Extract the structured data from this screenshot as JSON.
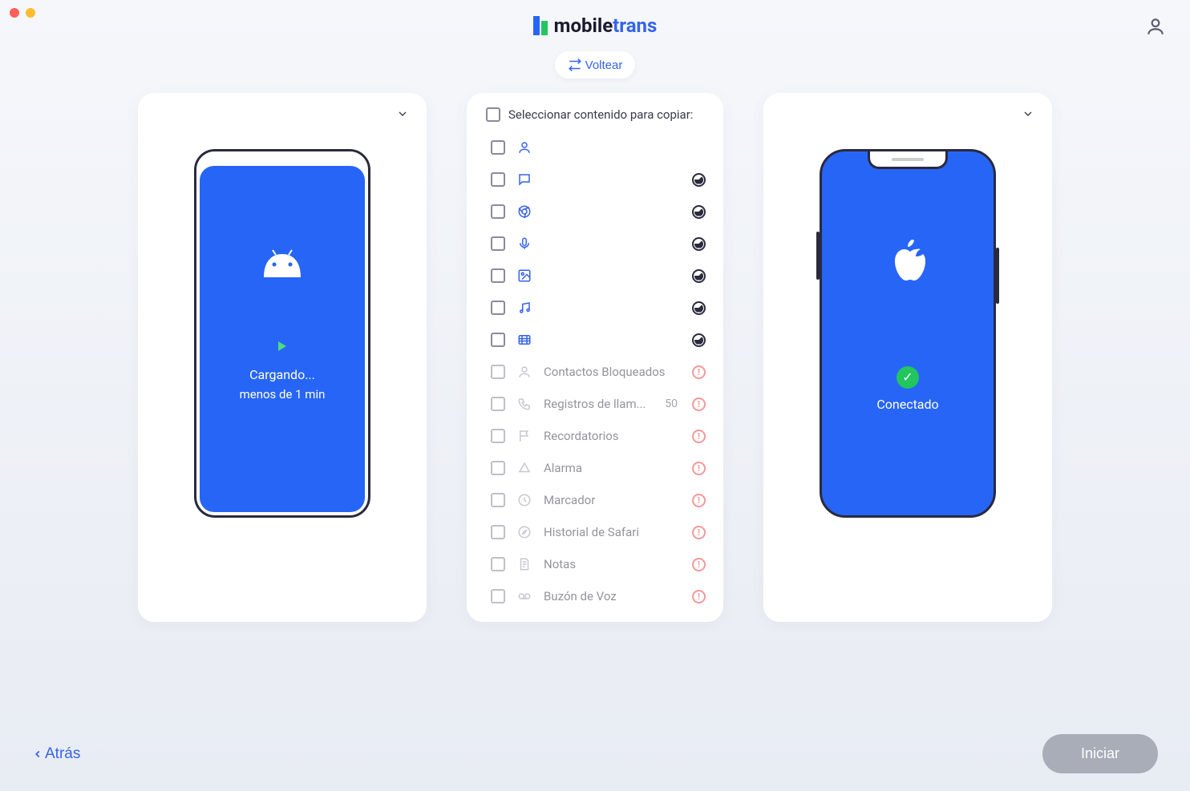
{
  "app": {
    "name_part1": "mobile",
    "name_part2": "trans"
  },
  "flip_label": "Voltear",
  "select_header": "Seleccionar contenido para copiar:",
  "source_device": {
    "loading": "Cargando...",
    "loading_sub": "menos de 1 min"
  },
  "dest_device": {
    "status": "Conectado"
  },
  "content_items": [
    {
      "icon": "person",
      "label": "",
      "status": "none",
      "enabled": true,
      "faded": true
    },
    {
      "icon": "message",
      "label": "",
      "status": "loading",
      "enabled": true,
      "faded": true
    },
    {
      "icon": "chrome",
      "label": "",
      "status": "loading",
      "enabled": true,
      "faded": true
    },
    {
      "icon": "mic",
      "label": "",
      "status": "loading",
      "enabled": true,
      "faded": true
    },
    {
      "icon": "image",
      "label": "",
      "status": "loading",
      "enabled": true,
      "faded": true
    },
    {
      "icon": "music",
      "label": "",
      "status": "loading",
      "enabled": true,
      "faded": true
    },
    {
      "icon": "video",
      "label": "",
      "status": "loading",
      "enabled": true,
      "faded": true
    },
    {
      "icon": "person",
      "label": "Contactos Bloqueados",
      "status": "warn",
      "enabled": false
    },
    {
      "icon": "phone",
      "label": "Registros de llam...",
      "count": "50",
      "status": "warn",
      "enabled": false
    },
    {
      "icon": "flag",
      "label": "Recordatorios",
      "status": "warn",
      "enabled": false
    },
    {
      "icon": "alarm",
      "label": "Alarma",
      "status": "warn",
      "enabled": false
    },
    {
      "icon": "bookmark",
      "label": "Marcador",
      "status": "warn",
      "enabled": false
    },
    {
      "icon": "safari",
      "label": "Historial de Safari",
      "status": "warn",
      "enabled": false
    },
    {
      "icon": "note",
      "label": "Notas",
      "status": "warn",
      "enabled": false
    },
    {
      "icon": "voicemail",
      "label": "Buzón de Voz",
      "status": "warn",
      "enabled": false
    }
  ],
  "footer": {
    "back": "Atrás",
    "start": "Iniciar"
  }
}
